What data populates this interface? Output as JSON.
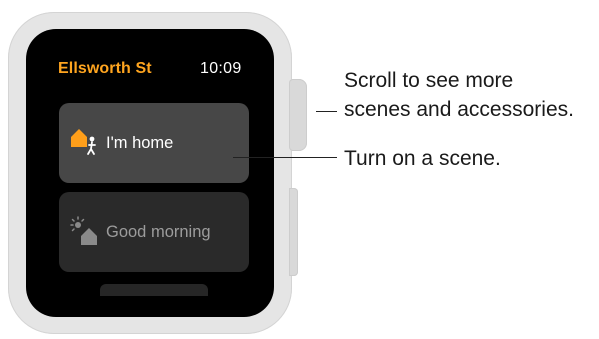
{
  "watch": {
    "app_title": "Ellsworth St",
    "time": "10:09",
    "scenes": [
      {
        "label": "I'm home",
        "icon": "home-person-icon",
        "state": "on"
      },
      {
        "label": "Good morning",
        "icon": "sun-home-icon",
        "state": "off"
      }
    ]
  },
  "callouts": {
    "scroll_line1": "Scroll to see more",
    "scroll_line2": "scenes and accessories.",
    "scene": "Turn on a scene."
  },
  "colors": {
    "accent": "#ffa51f",
    "scene_on": "#474747",
    "scene_off": "#2a2a2a",
    "case": "#e5e5e5"
  }
}
